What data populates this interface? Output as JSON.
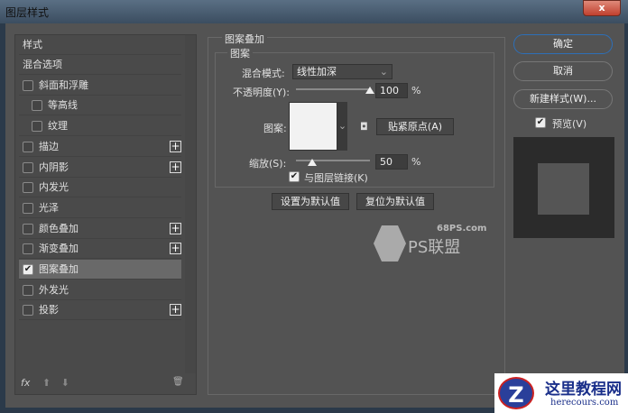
{
  "window": {
    "title": "图层样式",
    "close": "x"
  },
  "styles": {
    "header": "样式",
    "items": [
      {
        "label": "混合选项"
      },
      {
        "label": "斜面和浮雕",
        "checked": false
      },
      {
        "label": "等高线",
        "checked": false
      },
      {
        "label": "纹理",
        "checked": false
      },
      {
        "label": "描边",
        "checked": false,
        "plus": "+"
      },
      {
        "label": "内阴影",
        "checked": false,
        "plus": "+"
      },
      {
        "label": "内发光",
        "checked": false
      },
      {
        "label": "光泽",
        "checked": false
      },
      {
        "label": "颜色叠加",
        "checked": false,
        "plus": "+"
      },
      {
        "label": "渐变叠加",
        "checked": false,
        "plus": "+"
      },
      {
        "label": "图案叠加",
        "checked": true
      },
      {
        "label": "外发光",
        "checked": false
      },
      {
        "label": "投影",
        "checked": false,
        "plus": "+"
      }
    ],
    "footer": {
      "fx": "fx",
      "up": "⬆",
      "down": "⬇",
      "trash": "🗑"
    }
  },
  "panel": {
    "title": "图案叠加",
    "group": "图案",
    "blend_label": "混合模式:",
    "blend_value": "线性加深",
    "opacity_label": "不透明度(Y):",
    "opacity_value": "100",
    "opacity_percent": 100,
    "pct": "%",
    "pattern_label": "图案:",
    "snap_button": "贴紧原点(A)",
    "scale_label": "缩放(S):",
    "scale_value": "50",
    "scale_percent": 50,
    "link_label": "与图层链接(K)",
    "link_checked": true,
    "set_default": "设置为默认值",
    "reset_default": "复位为默认值"
  },
  "right": {
    "ok": "确定",
    "cancel": "取消",
    "new_style": "新建样式(W)...",
    "preview_label": "预览(V)",
    "preview_checked": true
  },
  "watermark": {
    "site": "68PS.com",
    "brand": "PS联盟"
  },
  "watermark2": {
    "name": "这里教程网",
    "url": "herecours.com"
  }
}
